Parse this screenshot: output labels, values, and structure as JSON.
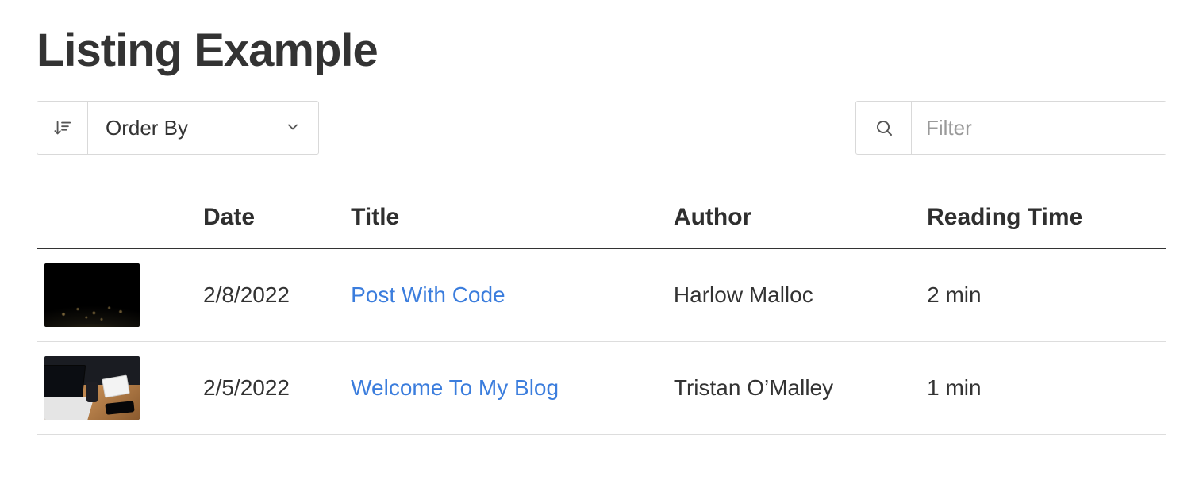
{
  "page": {
    "title": "Listing Example"
  },
  "controls": {
    "order_by_label": "Order By",
    "filter_placeholder": "Filter"
  },
  "table": {
    "headers": {
      "date": "Date",
      "title": "Title",
      "author": "Author",
      "reading_time": "Reading Time"
    },
    "rows": [
      {
        "thumb": "earth",
        "date": "2/8/2022",
        "title": "Post With Code",
        "author": "Harlow Malloc",
        "reading_time": "2 min"
      },
      {
        "thumb": "desk",
        "date": "2/5/2022",
        "title": "Welcome To My Blog",
        "author": "Tristan O’Malley",
        "reading_time": "1 min"
      }
    ]
  }
}
